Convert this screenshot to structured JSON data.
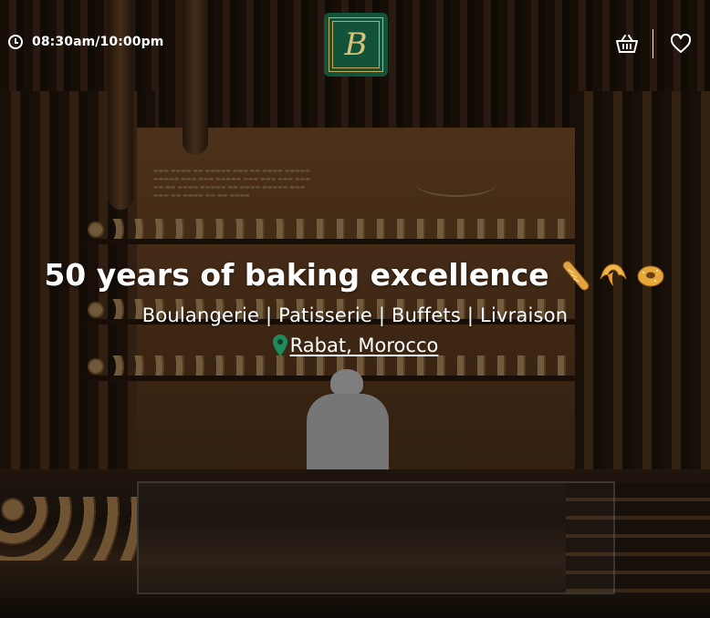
{
  "header": {
    "hours": "08:30am/10:00pm",
    "logo_letter": "B",
    "icons": {
      "hours": "clock-icon",
      "cart": "basket-icon",
      "favorites": "heart-icon"
    }
  },
  "hero": {
    "title": "50 years of baking excellence",
    "title_emojis": [
      "baguette-emoji",
      "croissant-emoji",
      "bagel-emoji"
    ],
    "subtitle": "Boulangerie | Patisserie | Buffets | Livraison",
    "location": "Rabat, Morocco",
    "location_icon": "map-pin-icon"
  },
  "colors": {
    "logo_bg": "#12533a",
    "logo_gold": "#c9a85a",
    "pin": "#1f8a5c",
    "text": "#ffffff"
  }
}
